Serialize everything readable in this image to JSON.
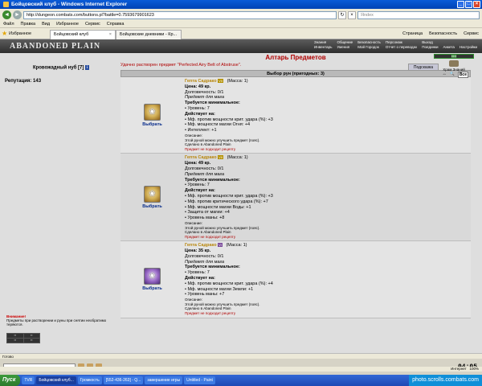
{
  "window": {
    "title": "Бойцовский клуб - Windows Internet Explorer"
  },
  "address": {
    "url": "http://dungeon.combats.com/buttons.pl?battle=0.7593679901623",
    "search_placeholder": "Яndex"
  },
  "menu": [
    "Файл",
    "Правка",
    "Вид",
    "Избранное",
    "Сервис",
    "Справка"
  ],
  "favorites": {
    "label": "Избранное"
  },
  "tabs": [
    {
      "label": "Бойцовский клуб"
    },
    {
      "label": "Бойцовские дневники - Кр..."
    }
  ],
  "toolbar": {
    "page": "Страница",
    "security": "Безопасность",
    "service": "Сервис"
  },
  "site": {
    "logo": "ABANDONED PLAIN",
    "topnav": [
      "Знания",
      "Общение",
      "Безопасность",
      "Персонаж",
      "Выход",
      "Инвентарь",
      "Умения",
      "Мой Городок",
      "Отчет о переводах",
      "Поединки",
      "Анкета",
      "Настройки"
    ]
  },
  "user": {
    "name": "Кровожадный нуб [7]",
    "level_badge": "i",
    "reputation": "Репутация: 143"
  },
  "altar": {
    "title": "Алтарь Предметов",
    "success": "Удачно растворен предмет \"Perfected Airy Belt of Abstruse\".",
    "hint_button": "Подсказка",
    "list_title": "Выбор рун (пригодных: 3)",
    "filter_value": "Все",
    "right_label": "Храм Знаний"
  },
  "items": [
    {
      "name": "Гепта Садрако",
      "tag": "VII",
      "mass": "(Масса: 1)",
      "price": "Цена: 49 кр.",
      "durability": "Долговечность: 0/1",
      "subtitle": "Предмет для мага",
      "req_title": "Требуется минимальное:",
      "req": "• Уровень: 7",
      "effect_title": "Действует на:",
      "effects": [
        "• Мф. против мощности крит. удара (%): +3",
        "• Мф. мощности магии Огня: +4",
        "• Интеллект: +1"
      ],
      "desc_title": "Описание:",
      "desc": "Этой руной можно улучшить предмет (пояс).",
      "made": "Сделано в Abandoned Plain",
      "notfit": "Предмет не подходит рецепту",
      "choose": "Выбрать"
    },
    {
      "name": "Гепта Садрако",
      "tag": "VII",
      "mass": "(Масса: 1)",
      "price": "Цена: 49 кр.",
      "durability": "Долговечность: 0/1",
      "subtitle": "Предмет для мага",
      "req_title": "Требуется минимальное:",
      "req": "• Уровень: 7",
      "effect_title": "Действует на:",
      "effects": [
        "• Мф. против мощности крит. удара (%): +3",
        "• Мф. против критического удара (%): +7",
        "• Мф. мощности магии Воды: +1",
        "• Защита от магии: +4",
        "• Уровень маны: +8"
      ],
      "desc_title": "Описание:",
      "desc": "Этой руной можно улучшить предмет (пояс).",
      "made": "Сделано в Abandoned Plain",
      "notfit": "Предмет не подходит рецепту",
      "choose": "Выбрать"
    },
    {
      "name": "Гепта Садрако",
      "tag": "VI",
      "mass": "(Масса: 1)",
      "price": "Цена: 35 кр.",
      "durability": "Долговечность: 0/1",
      "subtitle": "Предмет для мага",
      "req_title": "Требуется минимальное:",
      "req": "• Уровень: 7",
      "effect_title": "Действует на:",
      "effects": [
        "• Мф. против мощности крит. удара (%): +4",
        "• Мф. мощности магии Земли: +1",
        "• Уровень маны: +7"
      ],
      "desc_title": "Описание:",
      "desc": "Этой руной можно улучшить предмет (пояс).",
      "made": "Сделано в Abandoned Plain",
      "notfit": "Предмет не подходит рецепту",
      "choose": "Выбрать"
    }
  ],
  "warning": {
    "title": "Внимание!",
    "text": "Предметы при растворении и руны при снятии необратимо теряются."
  },
  "status": {
    "left": "Готово",
    "internet": "Интернет",
    "zoom": "100%"
  },
  "clock": "04:05",
  "taskbar": {
    "start": "Пуск",
    "tasks": [
      "TVR",
      "Бойцовский клуб...",
      "Громкость",
      "[552-436-263] - Q...",
      "завершение игры",
      "Untitled - Paint"
    ]
  },
  "watermark": "photo.scrolls.combats.com"
}
